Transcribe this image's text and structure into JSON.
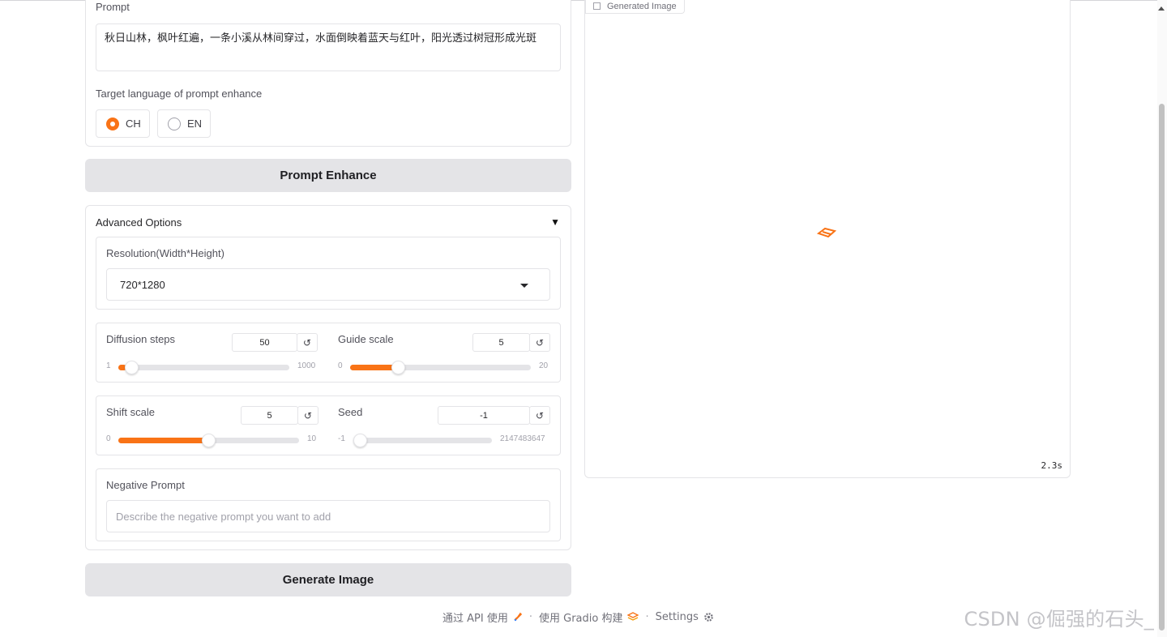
{
  "prompt": {
    "label": "Prompt",
    "value": "秋日山林，枫叶红遍，一条小溪从林间穿过，水面倒映着蓝天与红叶，阳光透过树冠形成光斑"
  },
  "target_language": {
    "label": "Target language of prompt enhance",
    "options": [
      {
        "label": "CH",
        "selected": true
      },
      {
        "label": "EN",
        "selected": false
      }
    ]
  },
  "prompt_enhance_button": "Prompt Enhance",
  "advanced": {
    "title": "Advanced Options",
    "caret": "▼",
    "resolution": {
      "label": "Resolution(Width*Height)",
      "value": "720*1280"
    },
    "diffusion_steps": {
      "label": "Diffusion steps",
      "value": "50",
      "min": "1",
      "max": "1000"
    },
    "guide_scale": {
      "label": "Guide scale",
      "value": "5",
      "min": "0",
      "max": "20"
    },
    "shift_scale": {
      "label": "Shift scale",
      "value": "5",
      "min": "0",
      "max": "10"
    },
    "seed": {
      "label": "Seed",
      "value": "-1",
      "min": "-1",
      "max": "2147483647"
    },
    "negative_prompt": {
      "label": "Negative Prompt",
      "placeholder": "Describe the negative prompt you want to add"
    },
    "reset_glyph": "↺"
  },
  "generate_button": "Generate Image",
  "output": {
    "label": "Generated Image",
    "timer": "2.3s"
  },
  "footer": {
    "api": "通过 API 使用",
    "gradio": "使用 Gradio 构建",
    "settings": "Settings",
    "separator": "·"
  },
  "watermark": "CSDN @倔强的石头_",
  "colors": {
    "accent": "#f97316",
    "button_bg": "#e4e4e7",
    "border": "#e4e4e7"
  },
  "icons": [
    "rocket-icon",
    "gradio-logo-icon",
    "gear-icon",
    "image-icon",
    "loading-spinner-icon",
    "reset-icon",
    "chevron-down-icon"
  ]
}
